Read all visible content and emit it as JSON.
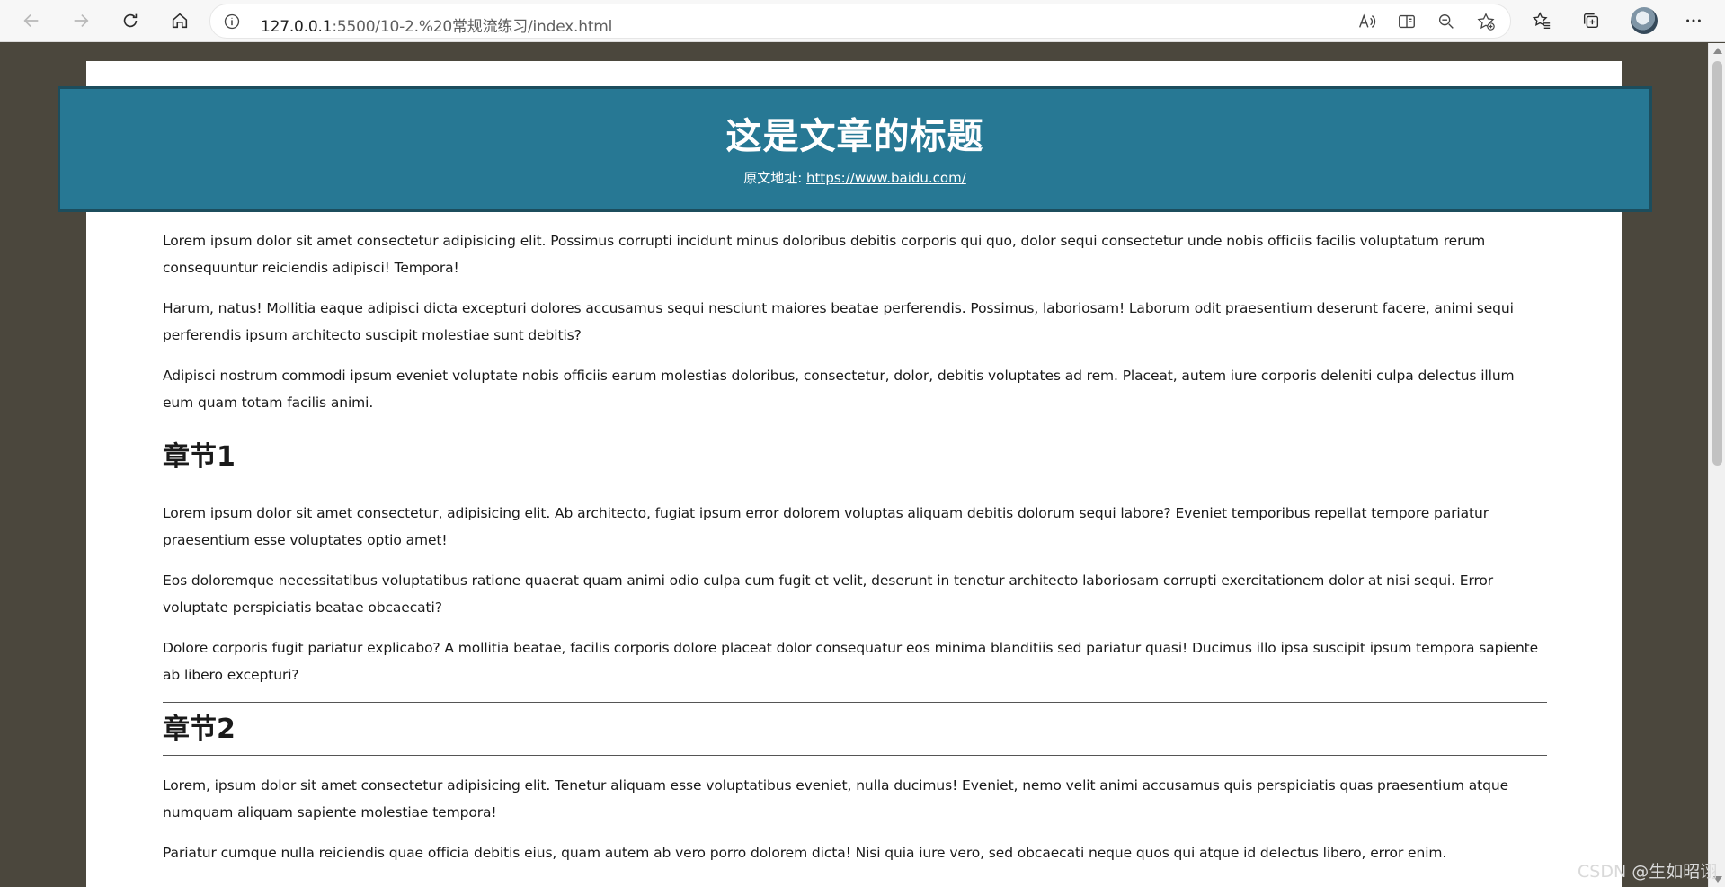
{
  "browser": {
    "url_host": "127.0.0.1",
    "url_path": ":5500/10-2.%20常规流练习/index.html"
  },
  "article": {
    "title": "这是文章的标题",
    "source_label": "原文地址: ",
    "source_link": "https://www.baidu.com/",
    "intro": [
      "Lorem ipsum dolor sit amet consectetur adipisicing elit. Possimus corrupti incidunt minus doloribus debitis corporis qui quo, dolor sequi consectetur unde nobis officiis facilis voluptatum rerum consequuntur reiciendis adipisci! Tempora!",
      "Harum, natus! Mollitia eaque adipisci dicta excepturi dolores accusamus sequi nesciunt maiores beatae perferendis. Possimus, laboriosam! Laborum odit praesentium deserunt facere, animi sequi perferendis ipsum architecto suscipit molestiae sunt debitis?",
      "Adipisci nostrum commodi ipsum eveniet voluptate nobis officiis earum molestias doloribus, consectetur, dolor, debitis voluptates ad rem. Placeat, autem iure corporis deleniti culpa delectus illum eum quam totam facilis animi."
    ],
    "sections": [
      {
        "heading": "章节1",
        "paragraphs": [
          "Lorem ipsum dolor sit amet consectetur, adipisicing elit. Ab architecto, fugiat ipsum error dolorem voluptas aliquam debitis dolorum sequi labore? Eveniet temporibus repellat tempore pariatur praesentium esse voluptates optio amet!",
          "Eos doloremque necessitatibus voluptatibus ratione quaerat quam animi odio culpa cum fugit et velit, deserunt in tenetur architecto laboriosam corrupti exercitationem dolor at nisi sequi. Error voluptate perspiciatis beatae obcaecati?",
          "Dolore corporis fugit pariatur explicabo? A mollitia beatae, facilis corporis dolore placeat dolor consequatur eos minima blanditiis sed pariatur quasi! Ducimus illo ipsa suscipit ipsum tempora sapiente ab libero excepturi?"
        ]
      },
      {
        "heading": "章节2",
        "paragraphs": [
          "Lorem, ipsum dolor sit amet consectetur adipisicing elit. Tenetur aliquam esse voluptatibus eveniet, nulla ducimus! Eveniet, nemo velit animi accusamus quis perspiciatis quas praesentium atque numquam aliquam sapiente molestiae tempora!",
          "Pariatur cumque nulla reiciendis quae officia debitis eius, quam autem ab vero porro dolorem dicta! Nisi quia iure vero, sed obcaecati neque quos qui atque id delectus libero, error enim."
        ]
      }
    ]
  },
  "watermark": "CSDN @生如昭诩"
}
